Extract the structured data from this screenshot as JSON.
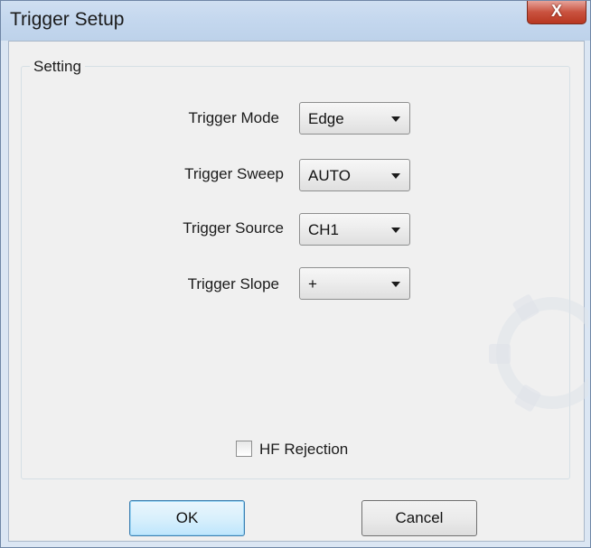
{
  "window": {
    "title": "Trigger Setup",
    "close_glyph": "X"
  },
  "group": {
    "label": "Setting"
  },
  "rows": [
    {
      "label": "Trigger Mode",
      "value": "Edge"
    },
    {
      "label": "Trigger Sweep",
      "value": "AUTO"
    },
    {
      "label": "Trigger Source",
      "value": "CH1"
    },
    {
      "label": "Trigger Slope",
      "value": "+"
    }
  ],
  "hf_rejection": {
    "label": "HF Rejection",
    "checked": false
  },
  "buttons": {
    "ok": "OK",
    "cancel": "Cancel"
  },
  "colors": {
    "titlebar": "#c4d7ee",
    "close_button": "#c9523f",
    "client_bg": "#f0f0f0",
    "ok_border": "#3c7fb1"
  }
}
